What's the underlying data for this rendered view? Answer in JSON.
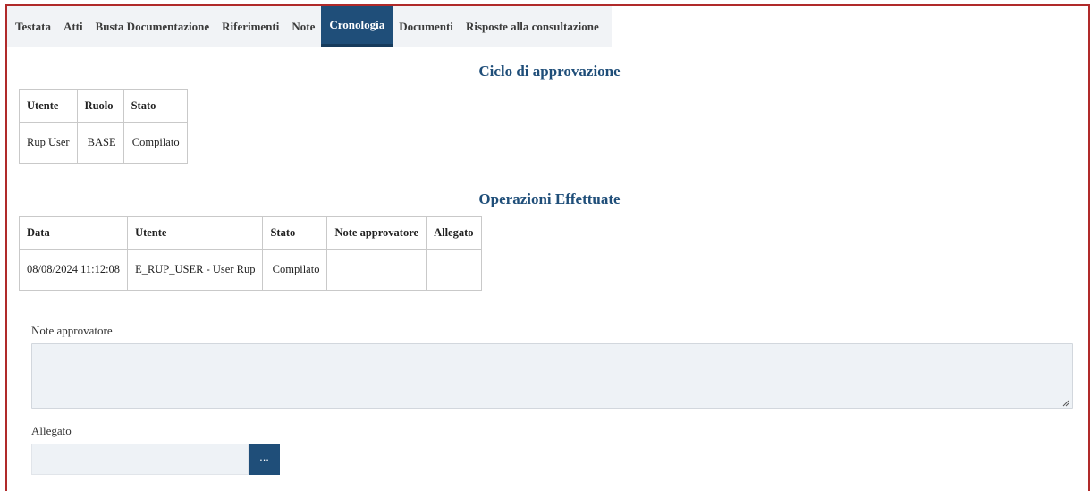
{
  "tabs": [
    {
      "label": "Testata"
    },
    {
      "label": "Atti"
    },
    {
      "label": "Busta Documentazione"
    },
    {
      "label": "Riferimenti"
    },
    {
      "label": "Note"
    },
    {
      "label": "Cronologia",
      "active": true
    },
    {
      "label": "Documenti"
    },
    {
      "label": "Risposte alla consultazione"
    }
  ],
  "approval": {
    "title": "Ciclo di approvazione",
    "headers": [
      "Utente",
      "Ruolo",
      "Stato"
    ],
    "rows": [
      [
        "Rup User",
        "BASE",
        "Compilato"
      ]
    ]
  },
  "operations": {
    "title": "Operazioni Effettuate",
    "headers": [
      "Data",
      "Utente",
      "Stato",
      "Note approvatore",
      "Allegato"
    ],
    "rows": [
      [
        "08/08/2024 11:12:08",
        "E_RUP_USER - User Rup",
        "Compilato",
        "",
        ""
      ]
    ]
  },
  "form": {
    "note_label": "Note approvatore",
    "note_value": "",
    "attachment_label": "Allegato",
    "attachment_value": "",
    "browse_label": "..."
  },
  "colors": {
    "accent": "#1f4e79",
    "frame_border": "#b02a2a",
    "input_bg": "#eef2f6"
  }
}
